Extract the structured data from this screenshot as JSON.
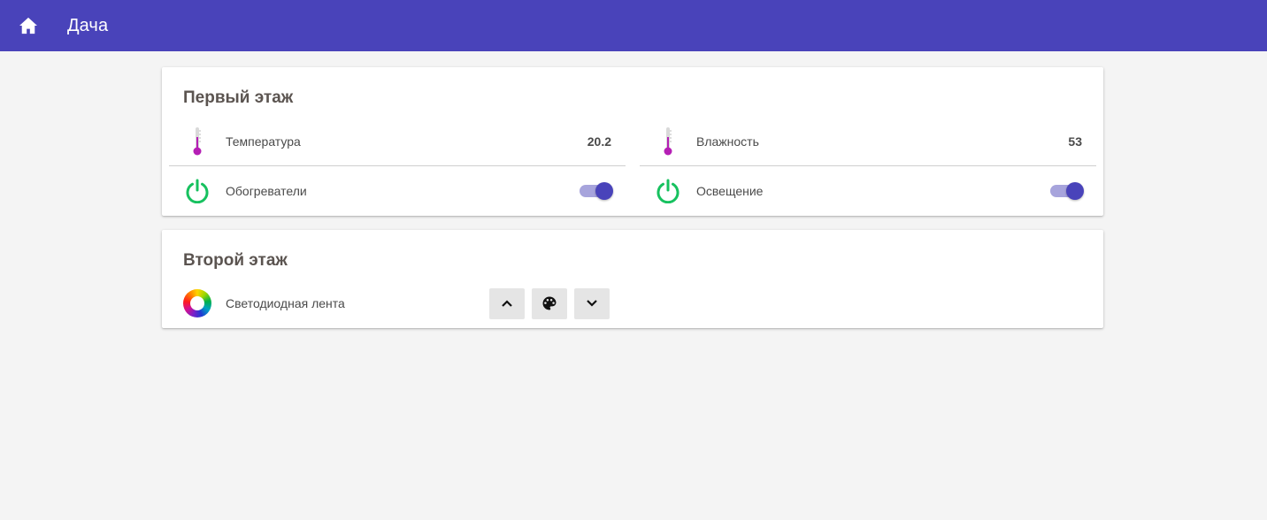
{
  "app": {
    "title": "Дача"
  },
  "colors": {
    "appbar": "#4943ba",
    "accent": "#4943ba",
    "power": "#17c15f",
    "thermometer": "#b51fb5"
  },
  "cards": [
    {
      "title": "Первый этаж",
      "rows": [
        {
          "icon": "thermometer-icon",
          "label": "Температура",
          "value": "20.2"
        },
        {
          "icon": "thermometer-icon",
          "label": "Влажность",
          "value": "53"
        },
        {
          "icon": "power-icon",
          "label": "Обогреватели",
          "state": "on"
        },
        {
          "icon": "power-icon",
          "label": "Освещение",
          "state": "on"
        }
      ]
    },
    {
      "title": "Второй этаж",
      "rows": [
        {
          "icon": "color-wheel-icon",
          "label": "Светодиодная лента",
          "controls": [
            "chevron-up-icon",
            "palette-icon",
            "chevron-down-icon"
          ]
        }
      ]
    }
  ]
}
